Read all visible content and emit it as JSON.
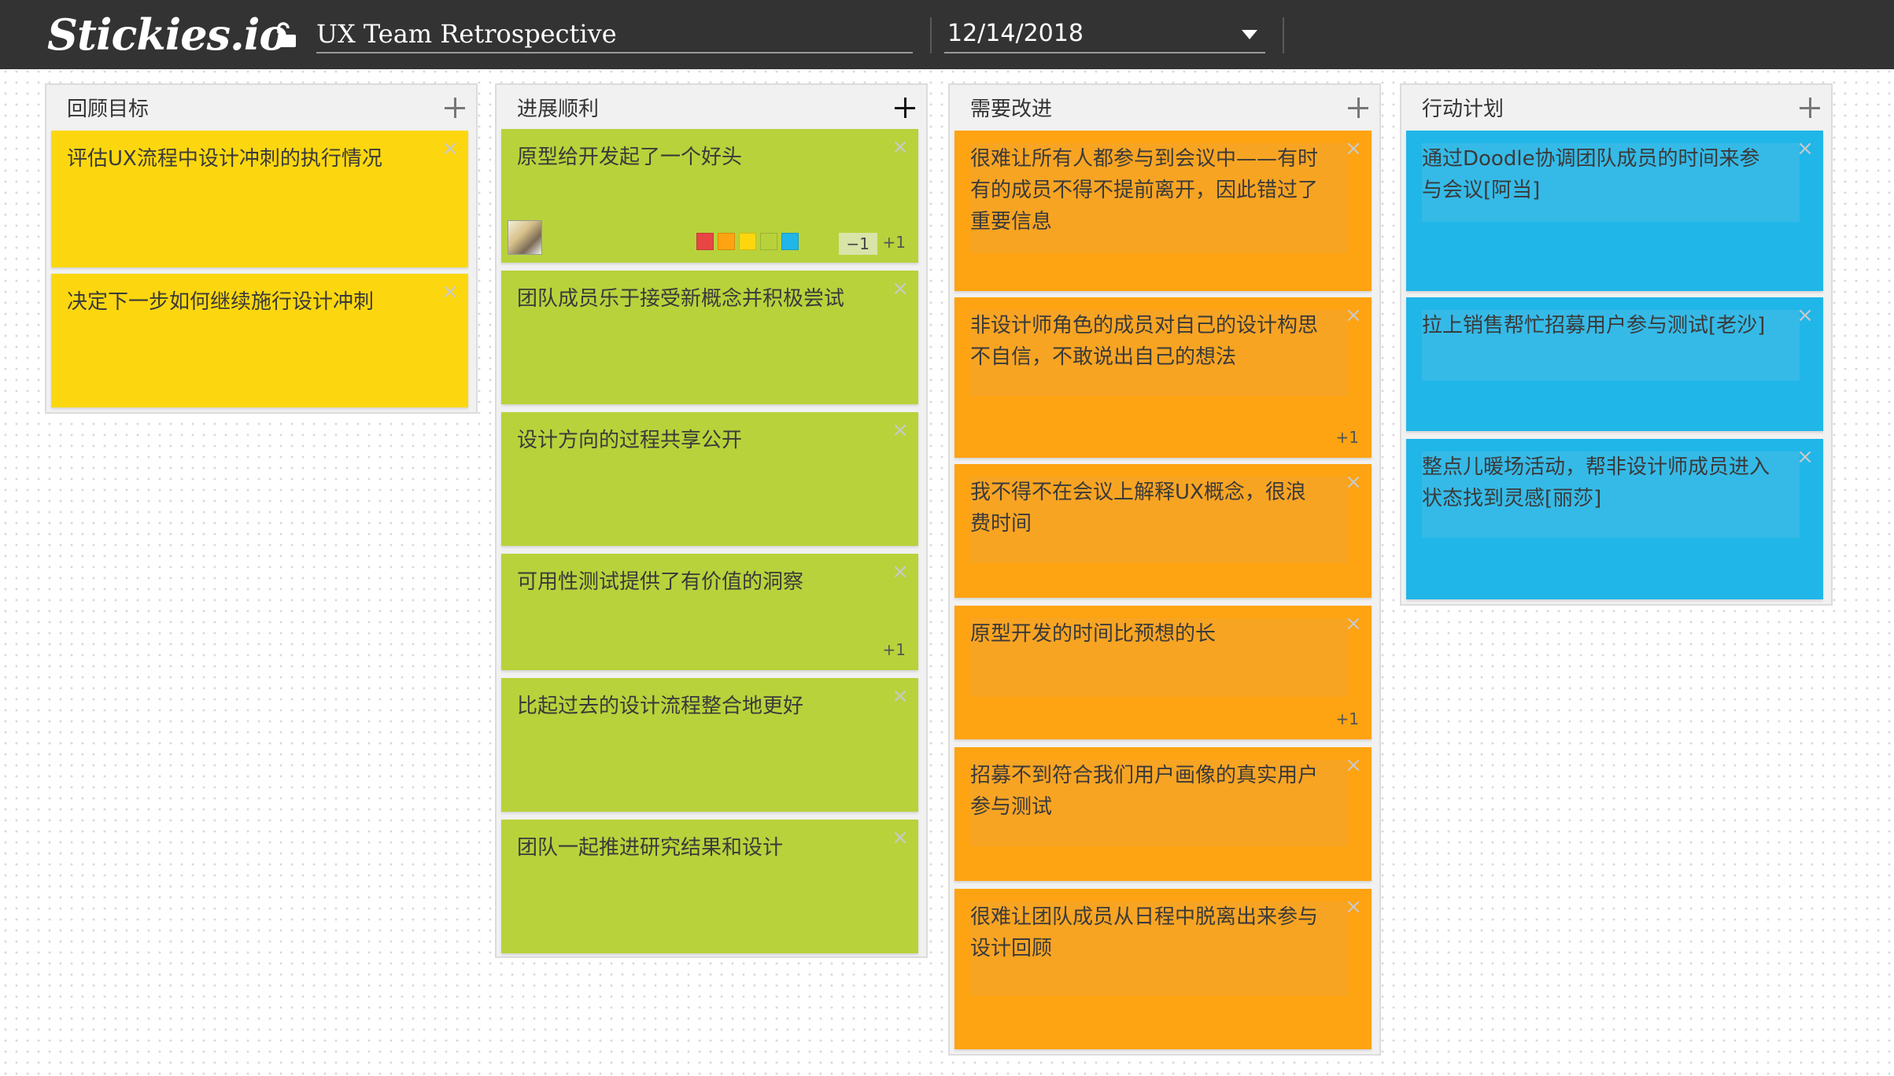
{
  "app": {
    "logo": "Stickies.io",
    "lock_icon": "unlocked-padlock-icon"
  },
  "board": {
    "title": "UX Team Retrospective",
    "date": "12/14/2018"
  },
  "colors": {
    "yellow": "#fcd70f",
    "green": "#b8d23b",
    "orange": "#fea311",
    "blue": "#20b6e8",
    "swatch_red": "#e84545"
  },
  "columns": [
    {
      "title": "回顾目标",
      "notes": [
        {
          "text": "评估UX流程中设计冲刺的执行情况"
        },
        {
          "text": "决定下一步如何继续施行设计冲刺"
        }
      ]
    },
    {
      "title": "进展顺利",
      "notes": [
        {
          "text": "原型给开发起了一个好头",
          "minus": "−1",
          "plus": "+1"
        },
        {
          "text": "团队成员乐于接受新概念并积极尝试"
        },
        {
          "text": "设计方向的过程共享公开"
        },
        {
          "text": "可用性测试提供了有价值的洞察",
          "plus": "+1"
        },
        {
          "text": "比起过去的设计流程整合地更好"
        },
        {
          "text": "团队一起推进研究结果和设计"
        }
      ]
    },
    {
      "title": "需要改进",
      "notes": [
        {
          "text": "很难让所有人都参与到会议中——有时有的成员不得不提前离开，因此错过了重要信息"
        },
        {
          "text": "非设计师角色的成员对自己的设计构思不自信，不敢说出自己的想法",
          "plus": "+1"
        },
        {
          "text": "我不得不在会议上解释UX概念，很浪费时间"
        },
        {
          "text": "原型开发的时间比预想的长",
          "plus": "+1"
        },
        {
          "text": "招募不到符合我们用户画像的真实用户参与测试"
        },
        {
          "text": "很难让团队成员从日程中脱离出来参与设计回顾"
        }
      ]
    },
    {
      "title": "行动计划",
      "notes": [
        {
          "text": "通过Doodle协调团队成员的时间来参与会议[阿当]"
        },
        {
          "text": "拉上销售帮忙招募用户参与测试[老沙]"
        },
        {
          "text": "整点儿暖场活动，帮非设计师成员进入状态找到灵感[丽莎]"
        }
      ]
    }
  ],
  "close_glyph": "×"
}
